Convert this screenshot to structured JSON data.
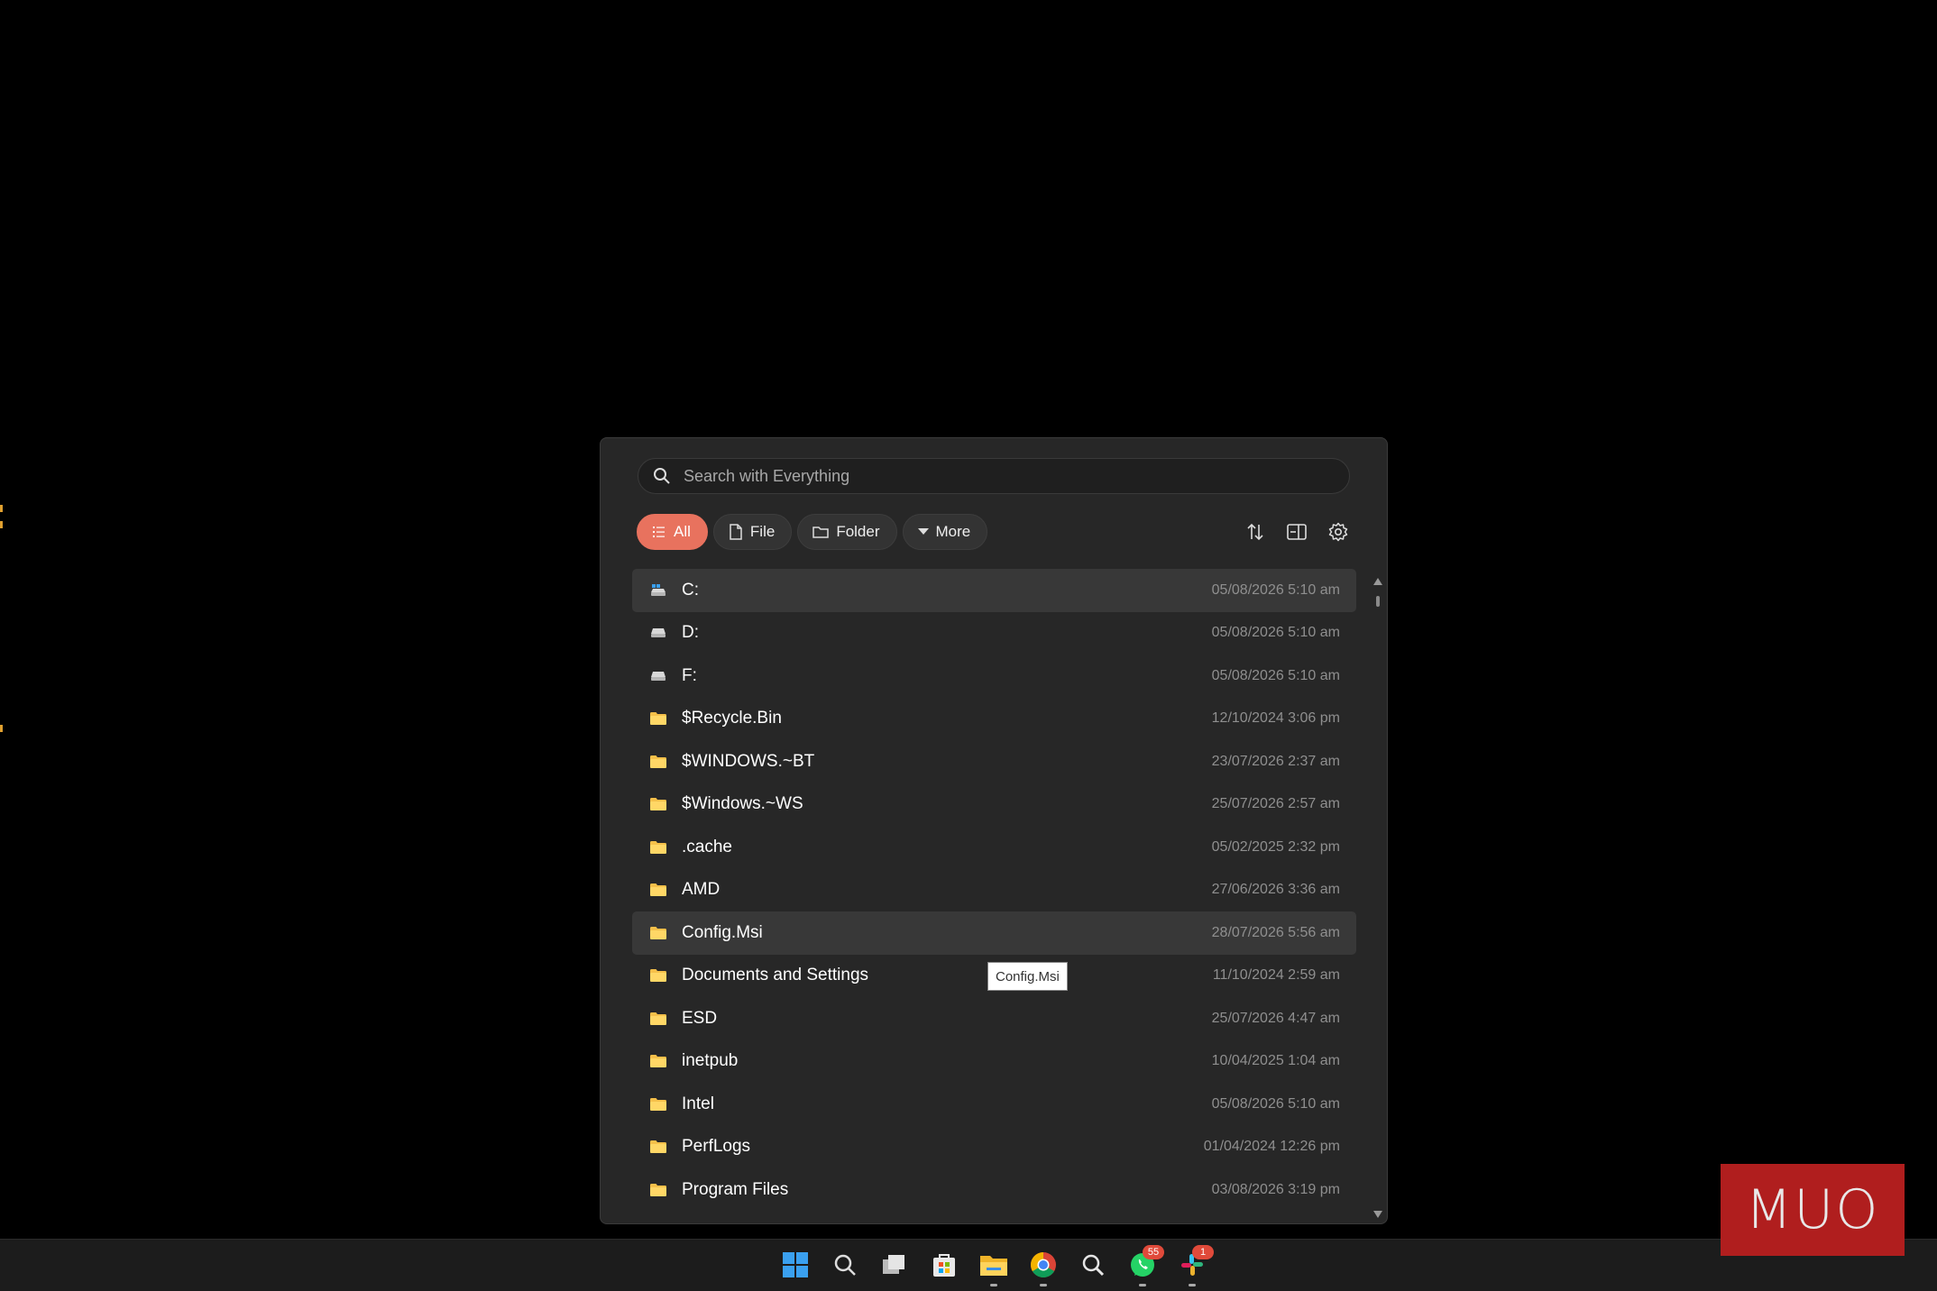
{
  "search": {
    "placeholder": "Search with Everything"
  },
  "filters": [
    {
      "label": "All",
      "icon": "list-icon",
      "active": true
    },
    {
      "label": "File",
      "icon": "file-icon",
      "active": false
    },
    {
      "label": "Folder",
      "icon": "folder-icon",
      "active": false
    },
    {
      "label": "More",
      "icon": "caret-down-icon",
      "active": false
    }
  ],
  "toolbar": {
    "sort_icon": "sort-icon",
    "preview_icon": "preview-pane-icon",
    "settings_icon": "gear-icon"
  },
  "results": [
    {
      "name": "C:",
      "date": "05/08/2026 5:10 am",
      "icon": "system-drive-icon"
    },
    {
      "name": "D:",
      "date": "05/08/2026 5:10 am",
      "icon": "drive-icon"
    },
    {
      "name": "F:",
      "date": "05/08/2026 5:10 am",
      "icon": "drive-icon"
    },
    {
      "name": "$Recycle.Bin",
      "date": "12/10/2024 3:06 pm",
      "icon": "folder-icon"
    },
    {
      "name": "$WINDOWS.~BT",
      "date": "23/07/2026 2:37 am",
      "icon": "folder-icon"
    },
    {
      "name": "$Windows.~WS",
      "date": "25/07/2026 2:57 am",
      "icon": "folder-icon"
    },
    {
      "name": ".cache",
      "date": "05/02/2025 2:32 pm",
      "icon": "folder-icon"
    },
    {
      "name": "AMD",
      "date": "27/06/2026 3:36 am",
      "icon": "folder-icon"
    },
    {
      "name": "Config.Msi",
      "date": "28/07/2026 5:56 am",
      "icon": "folder-icon"
    },
    {
      "name": "Documents and Settings",
      "date": "11/10/2024 2:59 am",
      "icon": "folder-icon"
    },
    {
      "name": "ESD",
      "date": "25/07/2026 4:47 am",
      "icon": "folder-icon"
    },
    {
      "name": "inetpub",
      "date": "10/04/2025 1:04 am",
      "icon": "folder-icon"
    },
    {
      "name": "Intel",
      "date": "05/08/2026 5:10 am",
      "icon": "folder-icon"
    },
    {
      "name": "PerfLogs",
      "date": "01/04/2024 12:26 pm",
      "icon": "folder-icon"
    },
    {
      "name": "Program Files",
      "date": "03/08/2026 3:19 pm",
      "icon": "folder-icon"
    }
  ],
  "tooltip": "Config.Msi",
  "taskbar": {
    "icons": [
      "start-icon",
      "search-icon",
      "task-view-icon",
      "store-icon",
      "file-explorer-icon",
      "chrome-icon",
      "everything-search-icon",
      "whatsapp-icon",
      "slack-icon"
    ],
    "whatsapp_badge": "55",
    "slack_badge": "1"
  },
  "watermark": "MUO",
  "colors": {
    "accent": "#e8725e",
    "panel": "#272727",
    "folder": "#f5c04a",
    "watermark": "#b01e1e"
  }
}
